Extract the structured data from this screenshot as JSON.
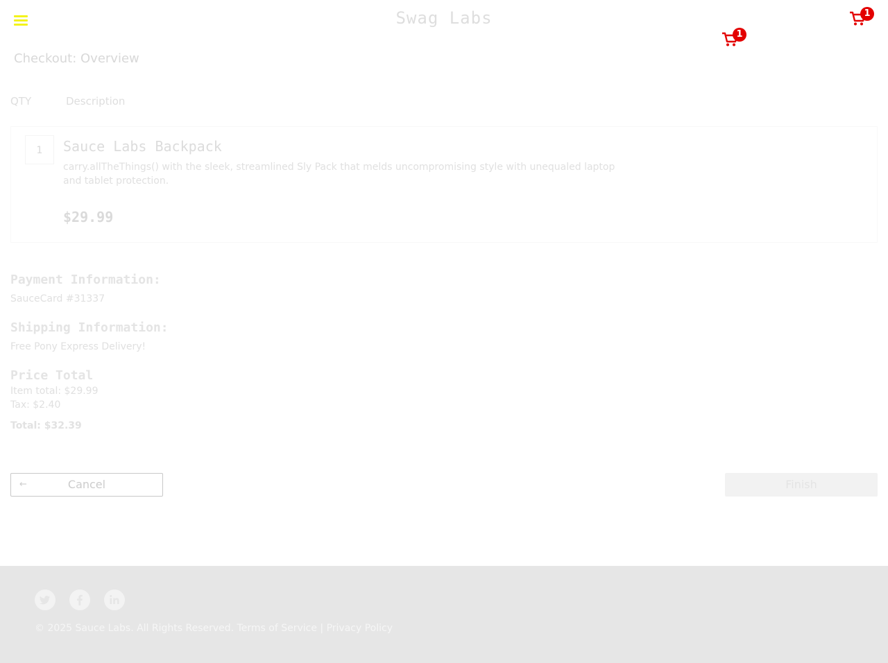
{
  "header": {
    "app_title": "Swag Labs",
    "cart_count_top": "1",
    "cart_count_mid": "1"
  },
  "page": {
    "title": "Checkout: Overview"
  },
  "list_header": {
    "qty": "QTY",
    "description": "Description"
  },
  "items": [
    {
      "quantity": "1",
      "name": "Sauce Labs Backpack",
      "description": "carry.allTheThings() with the sleek, streamlined Sly Pack that melds uncompromising style with unequaled laptop and tablet protection.",
      "price": "$29.99"
    }
  ],
  "summary": {
    "payment_label": "Payment Information:",
    "payment_value": "SauceCard #31337",
    "shipping_label": "Shipping Information:",
    "shipping_value": "Free Pony Express Delivery!",
    "price_total_label": "Price Total",
    "item_total": "Item total: $29.99",
    "tax": "Tax: $2.40",
    "total": "Total: $32.39"
  },
  "buttons": {
    "cancel": "Cancel",
    "finish": "Finish"
  },
  "footer": {
    "copyright": "© 2025 Sauce Labs. All Rights Reserved. ",
    "terms": "Terms of Service",
    "separator": " | ",
    "privacy": "Privacy Policy"
  },
  "icons": {
    "menu": "hamburger-icon",
    "cart": "shopping-cart-icon",
    "back": "arrow-left-icon",
    "twitter": "twitter-icon",
    "facebook": "facebook-icon",
    "linkedin": "linkedin-icon"
  },
  "colors": {
    "badge": "#e30000",
    "cart_icon": "#e30000",
    "menu_icon": "#f3f31c",
    "footer_bg": "#e6e6e6"
  }
}
